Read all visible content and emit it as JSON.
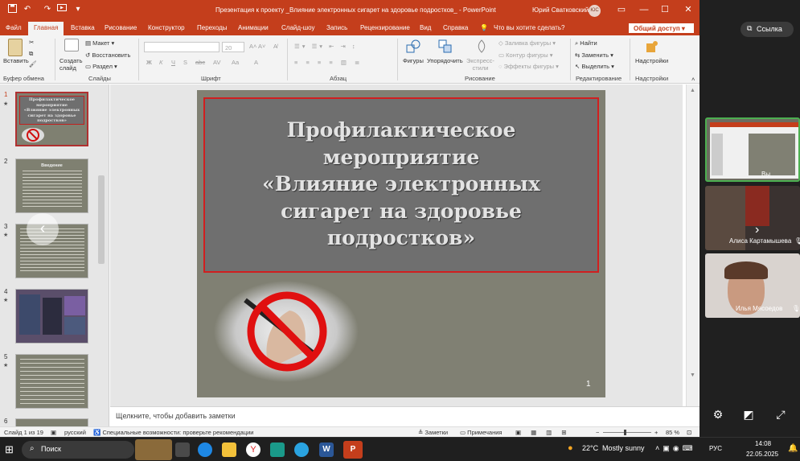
{
  "titlebar": {
    "autosave_icon": "save-icon",
    "undo": "↶",
    "redo": "↷",
    "title": "Презентация к проекту _Влияние электронных сигарет на здоровье подростков_ - PowerPoint",
    "user": "Юрий Сватковский",
    "avatar": "ЮС",
    "win_min": "—",
    "win_max": "☐",
    "win_close": "✕",
    "ribbon_toggle": "▭"
  },
  "tabs": [
    "Файл",
    "Главная",
    "Вставка",
    "Рисование",
    "Конструктор",
    "Переходы",
    "Анимации",
    "Слайд-шоу",
    "Запись",
    "Рецензирование",
    "Вид",
    "Справка"
  ],
  "tell_me": "Что вы хотите сделать?",
  "share": "Общий доступ",
  "ribbon": {
    "paste": "Вставить",
    "clipboard_group": "Буфер обмена",
    "new_slide": "Создать\nслайд",
    "layout": "Макет",
    "reset": "Восстановить",
    "section": "Раздел",
    "slides_group": "Слайды",
    "font_size": "20",
    "font_btns": [
      "Ж",
      "К",
      "Ч",
      "S",
      "abc",
      "AV",
      "Aa",
      "A"
    ],
    "font_group": "Шрифт",
    "paragraph_group": "Абзац",
    "shapes": "Фигуры",
    "arrange": "Упорядочить",
    "quick_styles": "Экспресс-\nстили",
    "shape_fill": "Заливка фигуры",
    "shape_outline": "Контур фигуры",
    "shape_effects": "Эффекты фигуры",
    "drawing_group": "Рисование",
    "find": "Найти",
    "replace": "Заменить",
    "select": "Выделить",
    "editing_group": "Редактирование",
    "addins": "Надстройки",
    "addins_group": "Надстройки"
  },
  "thumbnails": [
    {
      "num": "1",
      "star": "★",
      "lines": [
        "Профилактическое",
        "мероприятие",
        "«Влияние электронных",
        "сигарет на здоровье",
        "подростков»"
      ]
    },
    {
      "num": "2",
      "star": "",
      "lines": [
        "Введение"
      ]
    },
    {
      "num": "3",
      "star": "★",
      "lines": []
    },
    {
      "num": "4",
      "star": "★",
      "lines": []
    },
    {
      "num": "5",
      "star": "★",
      "lines": []
    },
    {
      "num": "6",
      "star": "",
      "lines": []
    }
  ],
  "slide": {
    "title_lines": [
      "Профилактическое",
      "мероприятие",
      "«Влияние электронных",
      "сигарет на здоровье",
      "подростков»"
    ],
    "number": "1"
  },
  "notes_placeholder": "Щелкните, чтобы добавить заметки",
  "status": {
    "slide": "Слайд 1 из 19",
    "lang": "русский",
    "accessibility": "Специальные возможности: проверьте рекомендации",
    "notes": "Заметки",
    "comments": "Примечания",
    "zoom": "85 %"
  },
  "meeting": {
    "link": "Ссылка",
    "participants": [
      {
        "name": "Вы"
      },
      {
        "name": "Алиса Картамышева"
      },
      {
        "name": "Илья Мясоедов"
      }
    ]
  },
  "taskbar": {
    "search": "Поиск",
    "temp": "22°C",
    "weather": "Mostly sunny",
    "lang": "РУС",
    "time": "14:08",
    "date": "22.05.2025"
  }
}
